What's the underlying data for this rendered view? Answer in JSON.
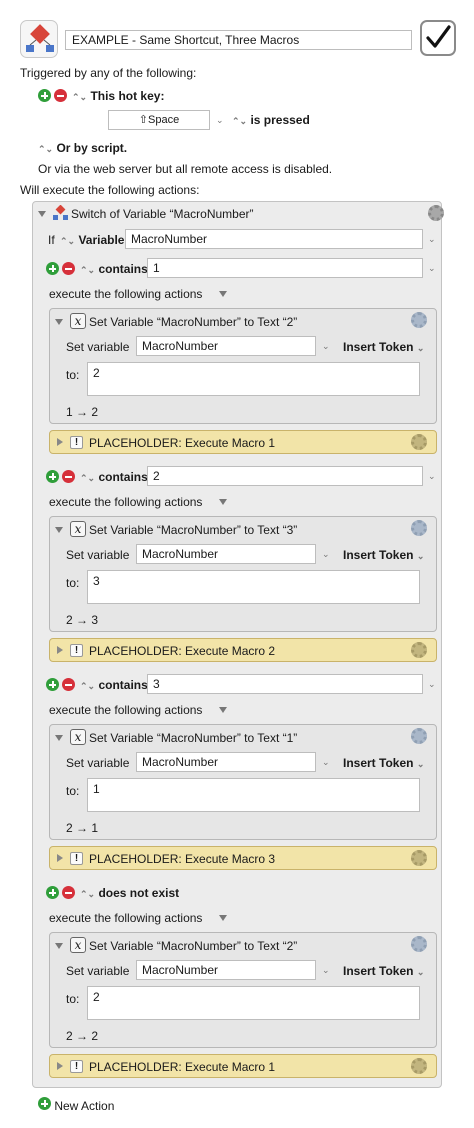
{
  "macro": {
    "name": "EXAMPLE - Same Shortcut, Three Macros",
    "enabled_glyph": "✓"
  },
  "trigger": {
    "header": "Triggered by any of the following:",
    "hotkey_label": "This hot key:",
    "hotkey_value": "⇧Space",
    "hotkey_state": "is pressed",
    "script_label": "Or by script.",
    "web_note": "Or via the web server but all remote access is disabled."
  },
  "actions_header": "Will execute the following actions:",
  "switch": {
    "title": "Switch of Variable “MacroNumber”",
    "if_label": "If",
    "source_label": "Variable",
    "variable": "MacroNumber",
    "execute_label": "execute the following actions",
    "cases": [
      {
        "condition": "contains",
        "value": "1",
        "set_title": "Set Variable “MacroNumber” to Text “2”",
        "set_label": "Set variable",
        "set_var": "MacroNumber",
        "insert_token": "Insert Token",
        "to_label": "to:",
        "to_value": "2",
        "preview": "1 → 2",
        "placeholder": "PLACEHOLDER: Execute Macro 1"
      },
      {
        "condition": "contains",
        "value": "2",
        "set_title": "Set Variable “MacroNumber” to Text “3”",
        "set_label": "Set variable",
        "set_var": "MacroNumber",
        "insert_token": "Insert Token",
        "to_label": "to:",
        "to_value": "3",
        "preview": "2 → 3",
        "placeholder": "PLACEHOLDER: Execute Macro 2"
      },
      {
        "condition": "contains",
        "value": "3",
        "set_title": "Set Variable “MacroNumber” to Text “1”",
        "set_label": "Set variable",
        "set_var": "MacroNumber",
        "insert_token": "Insert Token",
        "to_label": "to:",
        "to_value": "1",
        "preview": "2 → 1",
        "placeholder": "PLACEHOLDER: Execute Macro 3"
      },
      {
        "condition": "does not exist",
        "value": "",
        "set_title": "Set Variable “MacroNumber” to Text “2”",
        "set_label": "Set variable",
        "set_var": "MacroNumber",
        "insert_token": "Insert Token",
        "to_label": "to:",
        "to_value": "2",
        "preview": "2 → 2",
        "placeholder": "PLACEHOLDER: Execute Macro 1"
      }
    ]
  },
  "new_action": "New Action",
  "icons": {
    "variable_glyph": "𝑥",
    "warning_glyph": "!",
    "stepper_glyph": "⌃⌄"
  }
}
